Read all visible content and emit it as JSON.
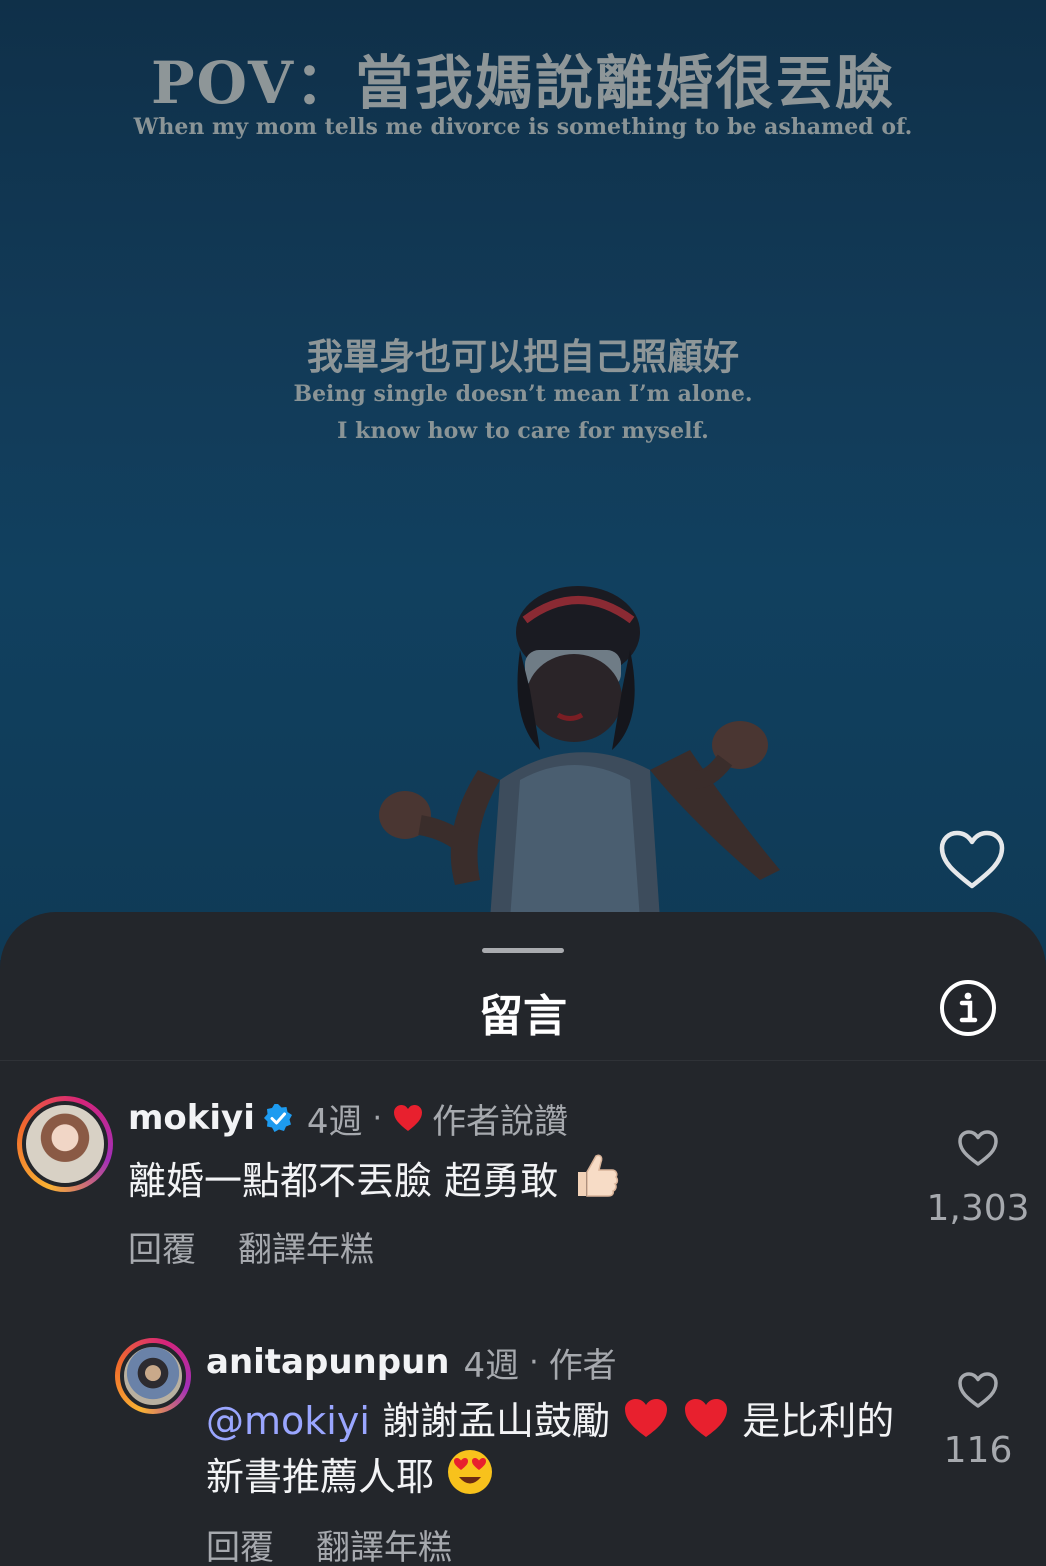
{
  "video": {
    "title": "POV：當我媽說離婚很丟臉",
    "subtitle": "When my mom tells me divorce is something to be ashamed of.",
    "mid_title": "我單身也可以把自己照顧好",
    "mid_line1": "Being single doesn’t mean I’m alone.",
    "mid_line2": "I know how to care for myself.",
    "like_icon": "heart-outline-icon"
  },
  "sheet": {
    "title": "留言",
    "info_icon": "info-icon"
  },
  "comments": [
    {
      "username": "mokiyi",
      "verified": true,
      "time": "4週",
      "separator": "·",
      "author_liked": "作者說讚",
      "text": "離婚一點都不丟臉 超勇敢",
      "emoji": "thumbs-up-icon",
      "reply_label": "回覆",
      "translate_label": "翻譯年糕",
      "likes": "1,303"
    },
    {
      "username": "anitapunpun",
      "time": "4週",
      "separator": "·",
      "badge": "作者",
      "mention": "@mokiyi",
      "text_a": "謝謝孟山鼓勵",
      "text_b": "是比利的新書推薦人耶",
      "emoji_hearts": "red-heart-icon",
      "emoji_face": "heart-eyes-icon",
      "reply_label": "回覆",
      "translate_label": "翻譯年糕",
      "likes": "116"
    }
  ],
  "colors": {
    "sheet_bg": "#23262b",
    "text_primary": "#f2f3f5",
    "text_secondary": "#a6a9ae",
    "mention": "#9aa6ff",
    "verified": "#1d9bf0",
    "heart_red": "#e8202e"
  }
}
